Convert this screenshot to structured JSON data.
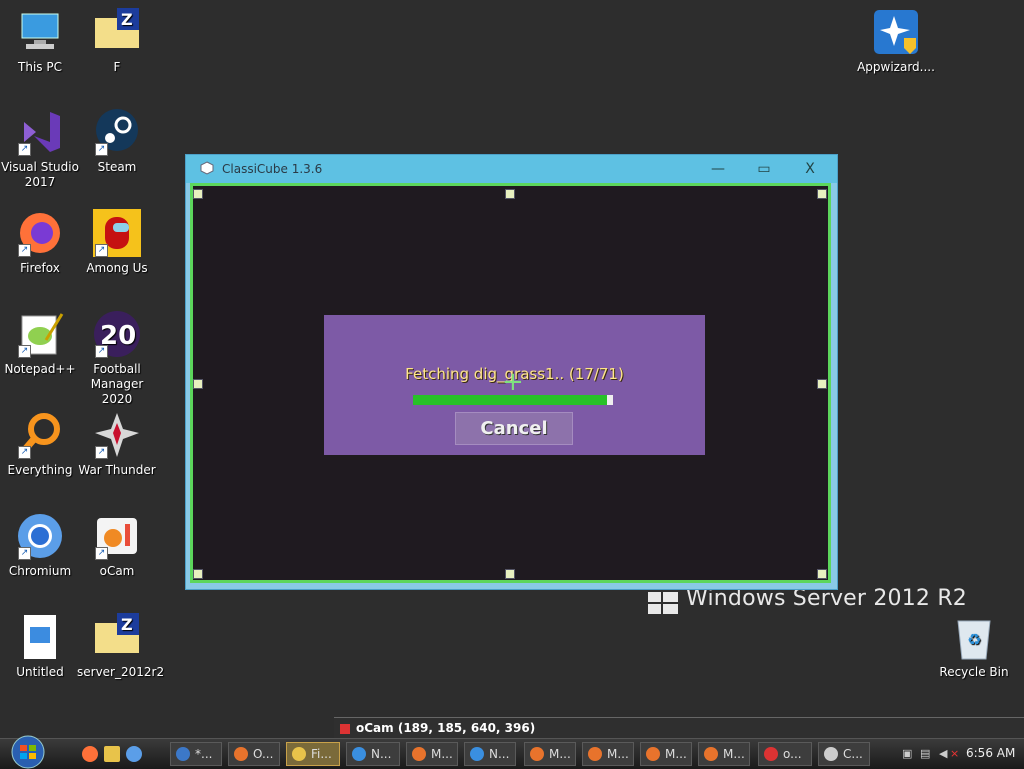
{
  "desktop": {
    "icons": [
      {
        "label": "This PC"
      },
      {
        "label": "F"
      },
      {
        "label": "Visual Studio 2017"
      },
      {
        "label": "Steam"
      },
      {
        "label": "Firefox"
      },
      {
        "label": "Among Us"
      },
      {
        "label": "Notepad++"
      },
      {
        "label": "Football Manager 2020"
      },
      {
        "label": "Everything"
      },
      {
        "label": "War Thunder"
      },
      {
        "label": "Chromium"
      },
      {
        "label": "oCam"
      },
      {
        "label": "Untitled"
      },
      {
        "label": "server_2012r2"
      },
      {
        "label": "Appwizard...."
      },
      {
        "label": "Recycle Bin"
      }
    ],
    "football_manager_badge": "20",
    "brand": "Windows Server 2012 R2"
  },
  "window": {
    "title": "ClassiCube 1.3.6",
    "minimize": "—",
    "maximize": "▭",
    "close": "X",
    "dialog": {
      "status": "Fetching dig_grass1.. (17/71)",
      "progress": 0.97,
      "cancel_label": "Cancel"
    }
  },
  "taskbar": {
    "tooltip": "oCam (189, 185, 640, 396)",
    "buttons": [
      {
        "label": "*...",
        "color": "#3c78c8"
      },
      {
        "label": "O...",
        "color": "#e8732c"
      },
      {
        "label": "Fi...",
        "color": "#e8c34a"
      },
      {
        "label": "N...",
        "color": "#3a8fe0"
      },
      {
        "label": "M...",
        "color": "#e8732c"
      },
      {
        "label": "N...",
        "color": "#3a8fe0"
      },
      {
        "label": "M...",
        "color": "#e8732c"
      },
      {
        "label": "M...",
        "color": "#e8732c"
      },
      {
        "label": "M...",
        "color": "#e8732c"
      },
      {
        "label": "M...",
        "color": "#e8732c"
      },
      {
        "label": "o...",
        "color": "#d33"
      },
      {
        "label": "C...",
        "color": "#ccc"
      }
    ],
    "clock": "6:56 AM"
  },
  "colors": {
    "accent_green": "#5cd65c",
    "dialog_purple": "#7d5aa6",
    "titlebar": "#5ec1e3"
  }
}
